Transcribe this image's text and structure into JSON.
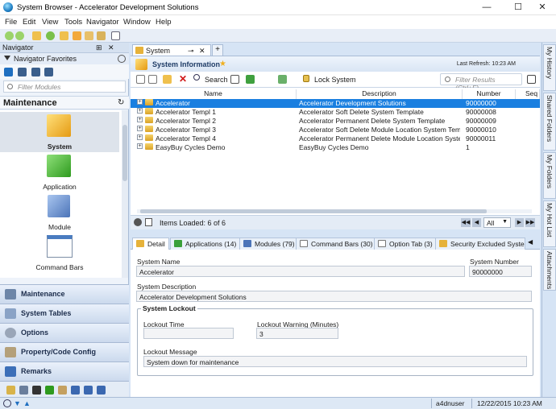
{
  "window": {
    "title": "System Browser - Accelerator Development Solutions",
    "minimize": "—",
    "maximize": "☐",
    "close": "✕"
  },
  "menu": [
    "File",
    "Edit",
    "View",
    "Tools",
    "Navigator",
    "Window",
    "Help"
  ],
  "navigator": {
    "title": "Navigator",
    "pin": "⊞",
    "close": "✕",
    "favorites_label": "Navigator Favorites",
    "filter_placeholder": "Filter Modules",
    "section_title": "Maintenance",
    "modules": [
      {
        "label": "System"
      },
      {
        "label": "Application"
      },
      {
        "label": "Module"
      },
      {
        "label": "Command Bars"
      }
    ],
    "groups": [
      {
        "label": "Maintenance"
      },
      {
        "label": "System Tables"
      },
      {
        "label": "Options"
      },
      {
        "label": "Property/Code Config"
      },
      {
        "label": "Remarks"
      }
    ]
  },
  "doc_tab": {
    "label": "System",
    "pin": "⊸",
    "close": "✕",
    "new": "+"
  },
  "header": {
    "title": "System Information",
    "last_refresh": "Last Refresh:  10:23 AM"
  },
  "content_toolbar": {
    "search_label": "Search",
    "lock_label": "Lock System",
    "filter_placeholder": "Filter Results (Ctrl+F)"
  },
  "grid": {
    "columns": [
      "Name",
      "Description",
      "Number",
      "Seq"
    ],
    "rows": [
      {
        "name": "Accelerator",
        "description": "Accelerator Development Solutions",
        "number": "90000000",
        "selected": true
      },
      {
        "name": "Accelerator Templ 1",
        "description": "Accelerator Soft Delete System Template",
        "number": "90000008"
      },
      {
        "name": "Accelerator Templ 2",
        "description": "Accelerator Permanent Delete System Template",
        "number": "90000009"
      },
      {
        "name": "Accelerator Templ 3",
        "description": "Accelerator Soft Delete Module Location System Temp",
        "number": "90000010"
      },
      {
        "name": "Accelerator Templ 4",
        "description": "Accelerator Permanent Delete Module Location System",
        "number": "90000011"
      },
      {
        "name": "EasyBuy Cycles Demo",
        "description": "EasyBuy Cycles Demo",
        "number": "1"
      }
    ]
  },
  "items_bar": {
    "text": "Items Loaded:  6  of 6",
    "page_select": "All"
  },
  "detail_tabs": [
    {
      "label": "Detail",
      "active": true
    },
    {
      "label": "Applications (14)"
    },
    {
      "label": "Modules (79)"
    },
    {
      "label": "Command Bars (30)"
    },
    {
      "label": "Option Tab (3)"
    },
    {
      "label": "Security Excluded System"
    }
  ],
  "detail": {
    "system_name_label": "System Name",
    "system_name": "Accelerator",
    "system_number_label": "System Number",
    "system_number": "90000000",
    "system_description_label": "System Description",
    "system_description": "Accelerator Development Solutions",
    "lockout_group": "System Lockout",
    "lockout_time_label": "Lockout Time",
    "lockout_time": "",
    "lockout_warning_label": "Lockout Warning (Minutes)",
    "lockout_warning": "3",
    "lockout_message_label": "Lockout Message",
    "lockout_message": "System down for maintenance"
  },
  "side_tabs": [
    "My History",
    "Shared Folders",
    "My Folders",
    "My Hot List",
    "Attachments"
  ],
  "status": {
    "user": "a4dnuser",
    "datetime": "12/22/2015  10:23 AM"
  },
  "colors": {
    "selection": "#1a7fe0",
    "accent": "#1f3c66",
    "folder": "#e6b23a"
  }
}
